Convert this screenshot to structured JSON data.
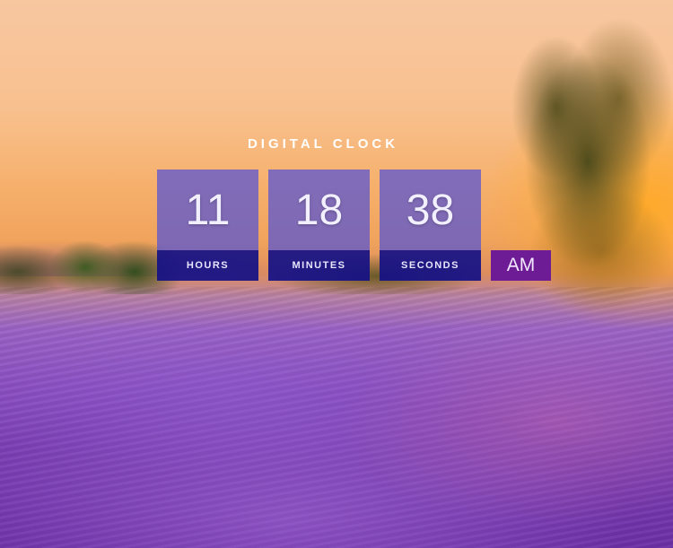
{
  "clock": {
    "title": "DIGITAL CLOCK",
    "hours": "11",
    "minutes": "18",
    "seconds": "38",
    "hours_label": "HOURS",
    "minutes_label": "MINUTES",
    "seconds_label": "SECONDS",
    "period": "AM"
  },
  "colors": {
    "digit_panel": "#5f58cd",
    "label_bar": "#141087",
    "ampm_badge": "#6e1c95",
    "text": "#ffffff"
  }
}
